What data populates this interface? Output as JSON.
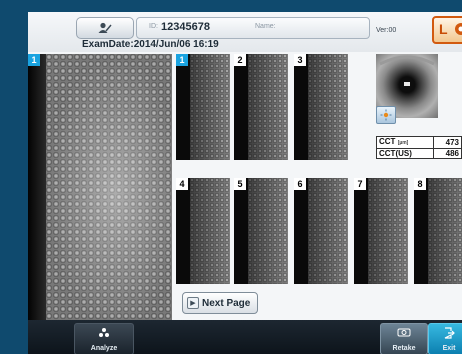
{
  "header": {
    "id_label": "ID:",
    "id_value": "12345678",
    "name_label": "Name:",
    "version": "Ver:00",
    "eye_side": "L",
    "exam_date": "ExamDate:2014/Jun/06 16:19"
  },
  "main_image": {
    "number": "1"
  },
  "thumbnails_top": [
    "1",
    "2",
    "3"
  ],
  "thumbnails_bottom": [
    "4",
    "5",
    "6",
    "7",
    "8"
  ],
  "cct": {
    "rows": [
      {
        "label": "CCT",
        "unit": "[µm]",
        "value": "473"
      },
      {
        "label": "CCT(US)",
        "unit": "",
        "value": "486"
      }
    ]
  },
  "next_page_label": "Next Page",
  "bottom": {
    "analyze_label": "Analyze",
    "retake_label": "Retake",
    "exit_label": "Exit"
  },
  "colors": {
    "selected_tag": "#1aa3e0",
    "eye_side_accent": "#d25a10",
    "exit_accent": "#1aa3e0"
  }
}
